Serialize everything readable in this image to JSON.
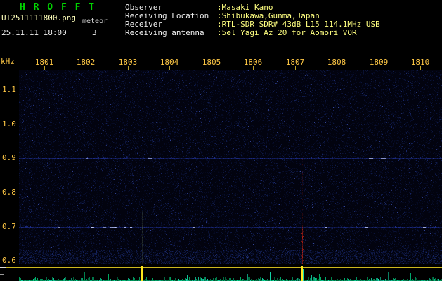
{
  "app": {
    "title": "H R O F F T"
  },
  "header": {
    "filename": "UT2511111800.png",
    "mode": "meteor",
    "datetime": "25.11.11 18:00",
    "count": "3",
    "info": [
      {
        "label": "Observer",
        "value": ":Masaki Kano"
      },
      {
        "label": "Receiving Location",
        "value": ":Shibukawa,Gunma,Japan"
      },
      {
        "label": "Receiver",
        "value": ":RTL-SDR SDR# 43dB L15 114.1MHz USB"
      },
      {
        "label": "Receiving antenna",
        "value": ":5el Yagi Az 20 for Aomori VOR"
      }
    ]
  },
  "chart_data": {
    "type": "heatmap",
    "subtype": "radio-meteor-echo-spectrogram",
    "title": "HROFFT 10-minute spectrogram with signal-level strip",
    "x_axis": {
      "unit": "UT time HHMM",
      "start": "18:00",
      "end": "18:10",
      "tick_labels": [
        "1801",
        "1802",
        "1803",
        "1804",
        "1805",
        "1806",
        "1807",
        "1808",
        "1809",
        "1810"
      ]
    },
    "y_axis": {
      "label": "kHz",
      "min": 0.59,
      "max": 1.16,
      "tick_labels": [
        "1.1",
        "1.0",
        "0.9",
        "0.8",
        "0.7",
        "0.6"
      ]
    },
    "carriers_khz": [
      0.9,
      0.7
    ],
    "events": [
      {
        "minute": 2.9,
        "approx_time": "18:02.9",
        "color": "#44544a",
        "alpha": 0.55,
        "span_frac": 0.27
      },
      {
        "minute": 6.7,
        "approx_time": "18:06.7",
        "color": "#cc2414",
        "alpha": 0.9,
        "span_frac": 0.19,
        "faint_span_frac": 0.55
      }
    ],
    "bottom_panel": {
      "description": "signal level / noise strip",
      "level_line_color": "#cdb81e",
      "event_marker_color": "#ffe51c",
      "noise_colors": [
        "#00b065",
        "#00cc84",
        "#00935a",
        "#12dfae"
      ]
    },
    "colors": {
      "spectrogram_bg": "#02030f",
      "noise_palette": [
        "#060b26",
        "#0a1238",
        "#101d4e",
        "#1b2a6e",
        "#36489e"
      ],
      "carrier_color": "#2336a2",
      "carrier_bright": "#c4d0ff",
      "title_green": "#00d400",
      "info_label": "#f0f0f0",
      "info_value": "#ffff80",
      "axis_label": "#ffc845"
    }
  }
}
